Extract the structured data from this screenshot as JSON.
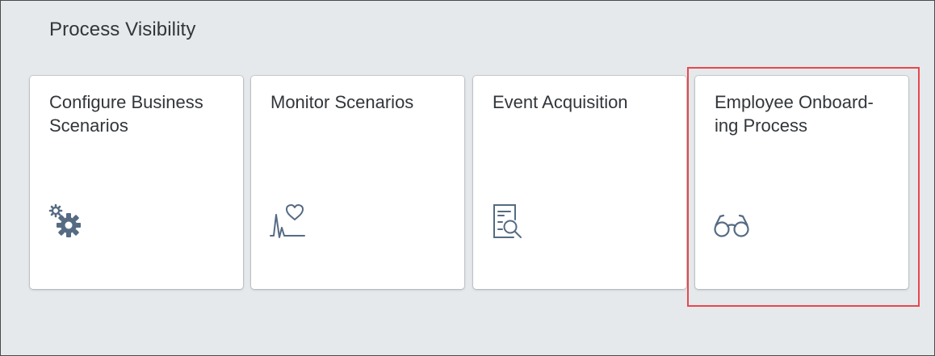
{
  "group": {
    "title": "Process Visibility"
  },
  "tiles": [
    {
      "title": "Configure Business Scenarios",
      "icon": "gears-icon"
    },
    {
      "title": "Monitor Scenarios",
      "icon": "heart-monitor-icon"
    },
    {
      "title": "Event Acquisition",
      "icon": "document-search-icon"
    },
    {
      "title": "Employee Onboard-ing Process",
      "icon": "glasses-icon"
    }
  ],
  "colors": {
    "background": "#e5e9eb",
    "tile": "#ffffff",
    "text": "#32363a",
    "icon": "#556b82",
    "highlight": "#e8474d"
  }
}
